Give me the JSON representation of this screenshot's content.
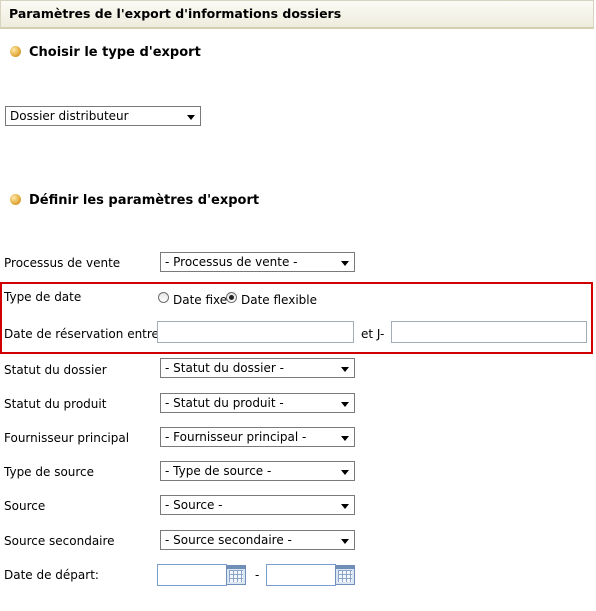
{
  "header": {
    "title": "Paramètres de l'export d'informations dossiers"
  },
  "section_export_type": {
    "title": "Choisir le type d'export"
  },
  "export_type": {
    "selected": "Dossier distributeur"
  },
  "section_params": {
    "title": "Définir les paramètres d'export"
  },
  "form": {
    "sales_process": {
      "label": "Processus de vente",
      "selected": "- Processus de vente -"
    },
    "date_type": {
      "label": "Type de date",
      "options": [
        {
          "label": "Date fixe",
          "checked": false
        },
        {
          "label": "Date flexible",
          "checked": true
        }
      ]
    },
    "booking_date": {
      "label": "Date de réservation entre J-",
      "and_label": "et J-",
      "from_value": "",
      "to_value": ""
    },
    "file_status": {
      "label": "Statut du dossier",
      "selected": "- Statut du dossier -"
    },
    "product_status": {
      "label": "Statut du produit",
      "selected": "- Statut du produit -"
    },
    "main_supplier": {
      "label": "Fournisseur principal",
      "selected": "- Fournisseur principal -"
    },
    "source_type": {
      "label": "Type de source",
      "selected": "- Type de source -"
    },
    "source": {
      "label": "Source",
      "selected": "- Source -"
    },
    "secondary_source": {
      "label": "Source secondaire",
      "selected": "- Source secondaire -"
    },
    "departure_date": {
      "label": "Date de départ:",
      "separator": "-",
      "from_value": "",
      "to_value": ""
    }
  },
  "colors": {
    "highlight_border": "#d00000",
    "bullet": "#e1a93c",
    "header_bg": "#eeecdd"
  }
}
